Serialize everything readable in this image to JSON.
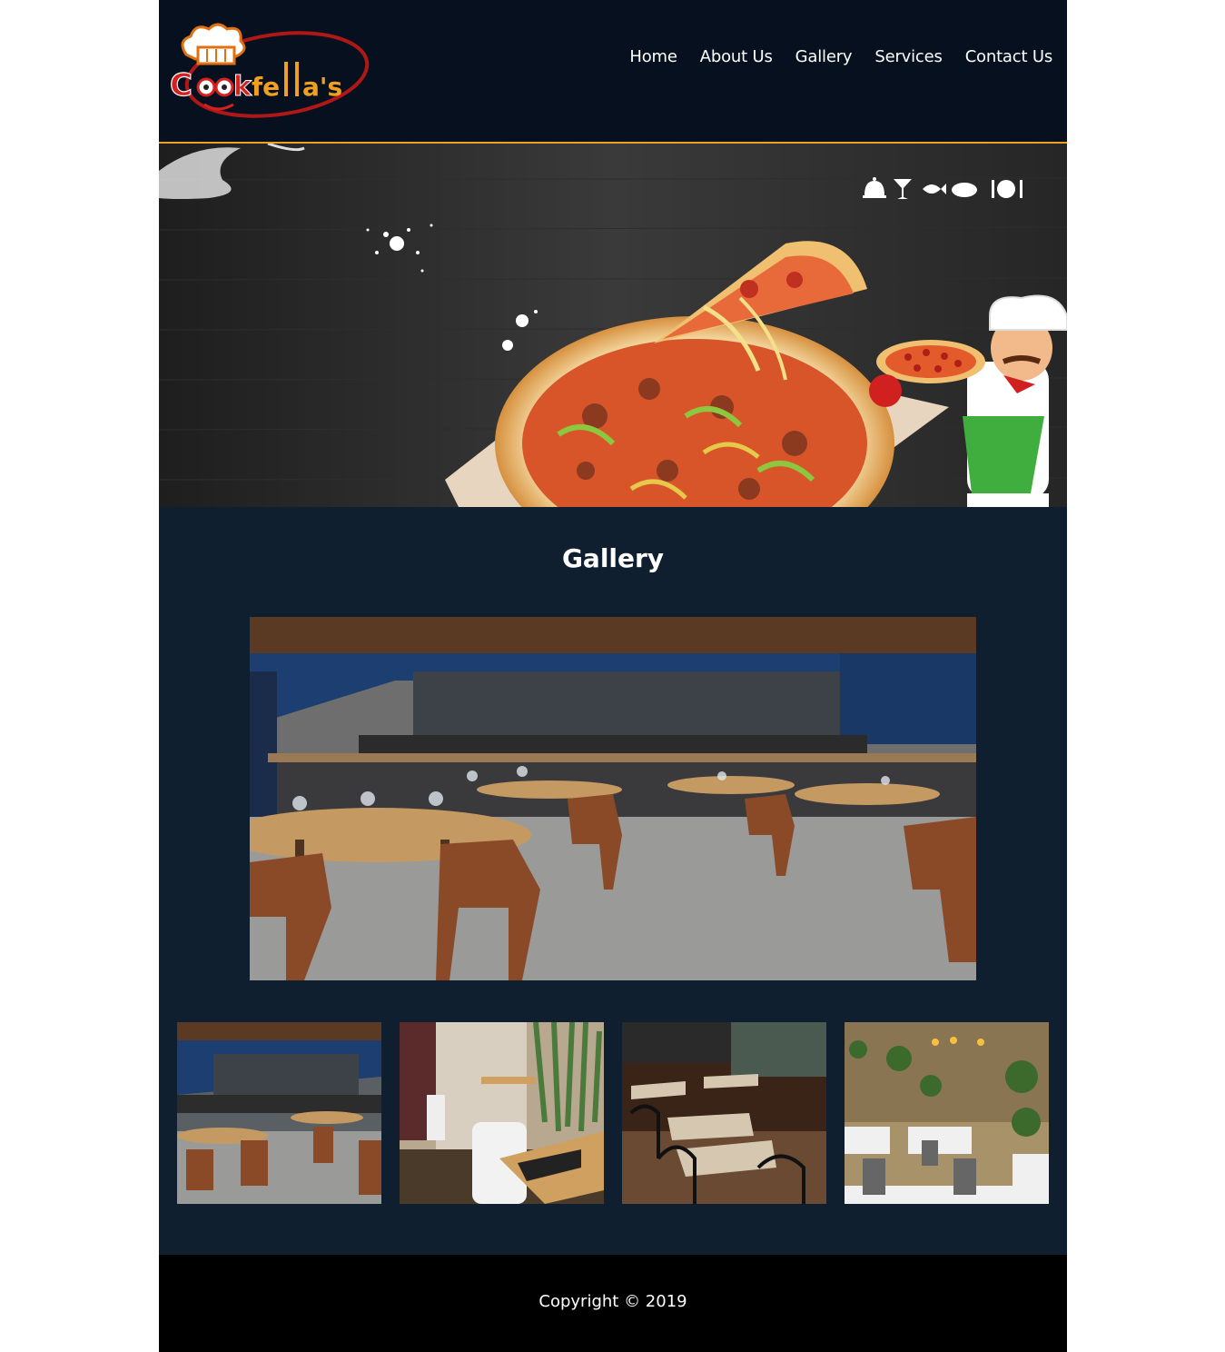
{
  "brand": {
    "name": "Cookfella's"
  },
  "nav": {
    "items": [
      {
        "label": "Home"
      },
      {
        "label": "About Us"
      },
      {
        "label": "Gallery"
      },
      {
        "label": "Services"
      },
      {
        "label": "Contact Us"
      }
    ]
  },
  "hero": {
    "icons": [
      "cloche-icon",
      "cocktail-icon",
      "fish-icon",
      "leaf-icon",
      "plate-cutlery-icon"
    ]
  },
  "gallery": {
    "title": "Gallery"
  },
  "footer": {
    "copyright": "Copyright © 2019"
  },
  "colors": {
    "header_bg": "#06101f",
    "page_bg": "#0f1f30",
    "accent_line": "#f0a020",
    "footer_bg": "#000000"
  }
}
